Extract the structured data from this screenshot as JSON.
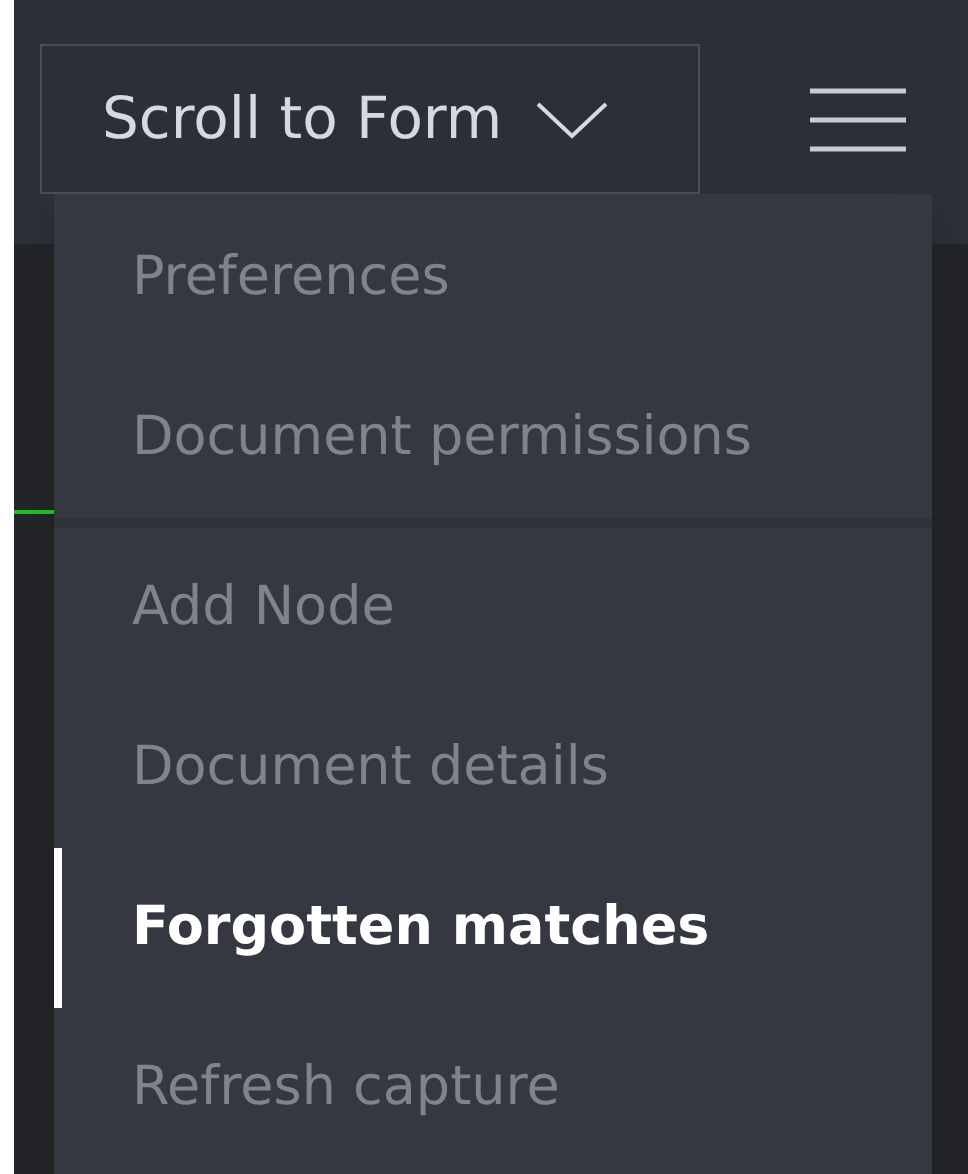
{
  "scroll_button": {
    "label": "Scroll to Form"
  },
  "menu": {
    "groups": [
      {
        "items": [
          {
            "label": "Preferences",
            "selected": false
          },
          {
            "label": "Document permissions",
            "selected": false
          }
        ]
      },
      {
        "items": [
          {
            "label": "Add Node",
            "selected": false
          },
          {
            "label": "Document details",
            "selected": false
          },
          {
            "label": "Forgotten matches",
            "selected": true
          },
          {
            "label": "Refresh capture",
            "selected": false
          }
        ]
      }
    ]
  }
}
